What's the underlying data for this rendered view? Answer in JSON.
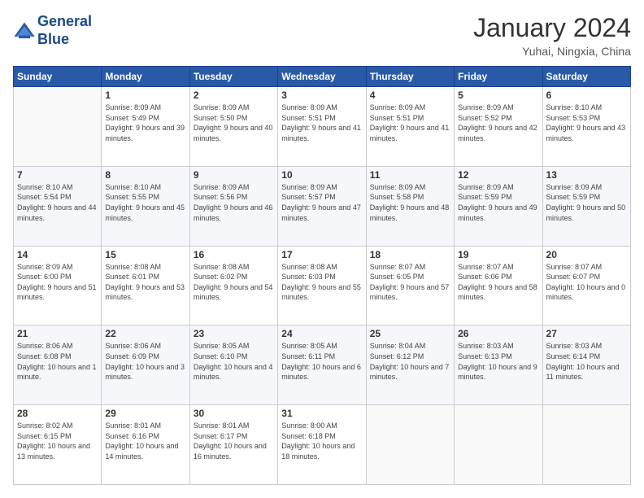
{
  "logo": {
    "line1": "General",
    "line2": "Blue"
  },
  "header": {
    "title": "January 2024",
    "subtitle": "Yuhai, Ningxia, China"
  },
  "weekdays": [
    "Sunday",
    "Monday",
    "Tuesday",
    "Wednesday",
    "Thursday",
    "Friday",
    "Saturday"
  ],
  "weeks": [
    [
      {
        "day": "",
        "sunrise": "",
        "sunset": "",
        "daylight": ""
      },
      {
        "day": "1",
        "sunrise": "Sunrise: 8:09 AM",
        "sunset": "Sunset: 5:49 PM",
        "daylight": "Daylight: 9 hours and 39 minutes."
      },
      {
        "day": "2",
        "sunrise": "Sunrise: 8:09 AM",
        "sunset": "Sunset: 5:50 PM",
        "daylight": "Daylight: 9 hours and 40 minutes."
      },
      {
        "day": "3",
        "sunrise": "Sunrise: 8:09 AM",
        "sunset": "Sunset: 5:51 PM",
        "daylight": "Daylight: 9 hours and 41 minutes."
      },
      {
        "day": "4",
        "sunrise": "Sunrise: 8:09 AM",
        "sunset": "Sunset: 5:51 PM",
        "daylight": "Daylight: 9 hours and 41 minutes."
      },
      {
        "day": "5",
        "sunrise": "Sunrise: 8:09 AM",
        "sunset": "Sunset: 5:52 PM",
        "daylight": "Daylight: 9 hours and 42 minutes."
      },
      {
        "day": "6",
        "sunrise": "Sunrise: 8:10 AM",
        "sunset": "Sunset: 5:53 PM",
        "daylight": "Daylight: 9 hours and 43 minutes."
      }
    ],
    [
      {
        "day": "7",
        "sunrise": "Sunrise: 8:10 AM",
        "sunset": "Sunset: 5:54 PM",
        "daylight": "Daylight: 9 hours and 44 minutes."
      },
      {
        "day": "8",
        "sunrise": "Sunrise: 8:10 AM",
        "sunset": "Sunset: 5:55 PM",
        "daylight": "Daylight: 9 hours and 45 minutes."
      },
      {
        "day": "9",
        "sunrise": "Sunrise: 8:09 AM",
        "sunset": "Sunset: 5:56 PM",
        "daylight": "Daylight: 9 hours and 46 minutes."
      },
      {
        "day": "10",
        "sunrise": "Sunrise: 8:09 AM",
        "sunset": "Sunset: 5:57 PM",
        "daylight": "Daylight: 9 hours and 47 minutes."
      },
      {
        "day": "11",
        "sunrise": "Sunrise: 8:09 AM",
        "sunset": "Sunset: 5:58 PM",
        "daylight": "Daylight: 9 hours and 48 minutes."
      },
      {
        "day": "12",
        "sunrise": "Sunrise: 8:09 AM",
        "sunset": "Sunset: 5:59 PM",
        "daylight": "Daylight: 9 hours and 49 minutes."
      },
      {
        "day": "13",
        "sunrise": "Sunrise: 8:09 AM",
        "sunset": "Sunset: 5:59 PM",
        "daylight": "Daylight: 9 hours and 50 minutes."
      }
    ],
    [
      {
        "day": "14",
        "sunrise": "Sunrise: 8:09 AM",
        "sunset": "Sunset: 6:00 PM",
        "daylight": "Daylight: 9 hours and 51 minutes."
      },
      {
        "day": "15",
        "sunrise": "Sunrise: 8:08 AM",
        "sunset": "Sunset: 6:01 PM",
        "daylight": "Daylight: 9 hours and 53 minutes."
      },
      {
        "day": "16",
        "sunrise": "Sunrise: 8:08 AM",
        "sunset": "Sunset: 6:02 PM",
        "daylight": "Daylight: 9 hours and 54 minutes."
      },
      {
        "day": "17",
        "sunrise": "Sunrise: 8:08 AM",
        "sunset": "Sunset: 6:03 PM",
        "daylight": "Daylight: 9 hours and 55 minutes."
      },
      {
        "day": "18",
        "sunrise": "Sunrise: 8:07 AM",
        "sunset": "Sunset: 6:05 PM",
        "daylight": "Daylight: 9 hours and 57 minutes."
      },
      {
        "day": "19",
        "sunrise": "Sunrise: 8:07 AM",
        "sunset": "Sunset: 6:06 PM",
        "daylight": "Daylight: 9 hours and 58 minutes."
      },
      {
        "day": "20",
        "sunrise": "Sunrise: 8:07 AM",
        "sunset": "Sunset: 6:07 PM",
        "daylight": "Daylight: 10 hours and 0 minutes."
      }
    ],
    [
      {
        "day": "21",
        "sunrise": "Sunrise: 8:06 AM",
        "sunset": "Sunset: 6:08 PM",
        "daylight": "Daylight: 10 hours and 1 minute."
      },
      {
        "day": "22",
        "sunrise": "Sunrise: 8:06 AM",
        "sunset": "Sunset: 6:09 PM",
        "daylight": "Daylight: 10 hours and 3 minutes."
      },
      {
        "day": "23",
        "sunrise": "Sunrise: 8:05 AM",
        "sunset": "Sunset: 6:10 PM",
        "daylight": "Daylight: 10 hours and 4 minutes."
      },
      {
        "day": "24",
        "sunrise": "Sunrise: 8:05 AM",
        "sunset": "Sunset: 6:11 PM",
        "daylight": "Daylight: 10 hours and 6 minutes."
      },
      {
        "day": "25",
        "sunrise": "Sunrise: 8:04 AM",
        "sunset": "Sunset: 6:12 PM",
        "daylight": "Daylight: 10 hours and 7 minutes."
      },
      {
        "day": "26",
        "sunrise": "Sunrise: 8:03 AM",
        "sunset": "Sunset: 6:13 PM",
        "daylight": "Daylight: 10 hours and 9 minutes."
      },
      {
        "day": "27",
        "sunrise": "Sunrise: 8:03 AM",
        "sunset": "Sunset: 6:14 PM",
        "daylight": "Daylight: 10 hours and 11 minutes."
      }
    ],
    [
      {
        "day": "28",
        "sunrise": "Sunrise: 8:02 AM",
        "sunset": "Sunset: 6:15 PM",
        "daylight": "Daylight: 10 hours and 13 minutes."
      },
      {
        "day": "29",
        "sunrise": "Sunrise: 8:01 AM",
        "sunset": "Sunset: 6:16 PM",
        "daylight": "Daylight: 10 hours and 14 minutes."
      },
      {
        "day": "30",
        "sunrise": "Sunrise: 8:01 AM",
        "sunset": "Sunset: 6:17 PM",
        "daylight": "Daylight: 10 hours and 16 minutes."
      },
      {
        "day": "31",
        "sunrise": "Sunrise: 8:00 AM",
        "sunset": "Sunset: 6:18 PM",
        "daylight": "Daylight: 10 hours and 18 minutes."
      },
      {
        "day": "",
        "sunrise": "",
        "sunset": "",
        "daylight": ""
      },
      {
        "day": "",
        "sunrise": "",
        "sunset": "",
        "daylight": ""
      },
      {
        "day": "",
        "sunrise": "",
        "sunset": "",
        "daylight": ""
      }
    ]
  ]
}
